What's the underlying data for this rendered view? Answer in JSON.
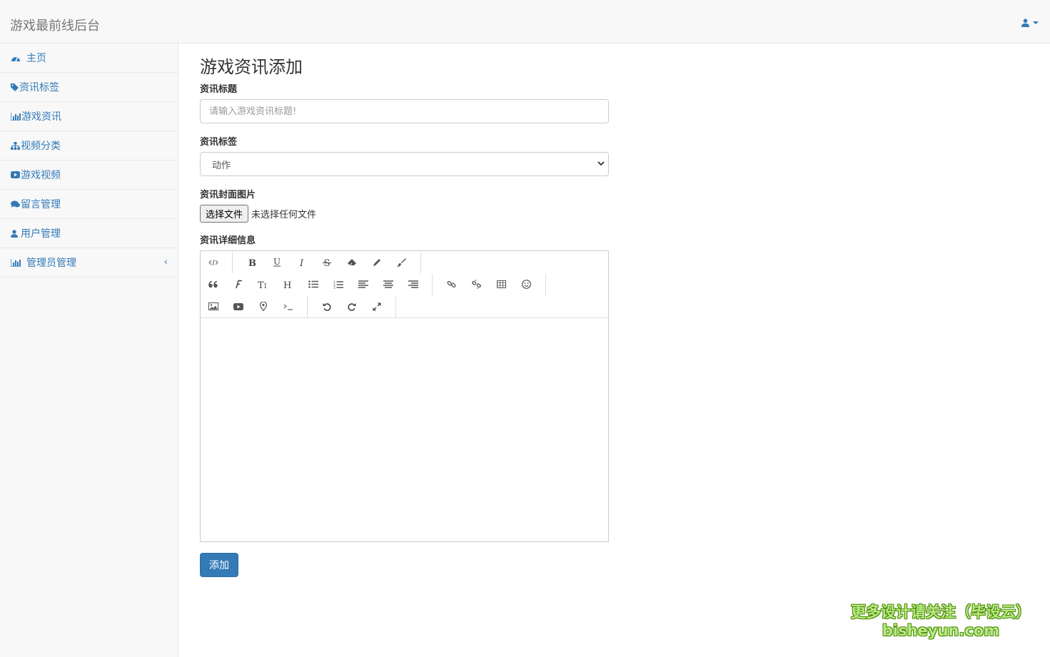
{
  "navbar": {
    "brand": "游戏最前线后台"
  },
  "sidebar": {
    "items": [
      {
        "label": "主页",
        "icon": "dashboard-icon"
      },
      {
        "label": "资讯标签",
        "icon": "tag-icon"
      },
      {
        "label": "游戏资讯",
        "icon": "bar-chart-icon"
      },
      {
        "label": "视频分类",
        "icon": "sitemap-icon"
      },
      {
        "label": "游戏视频",
        "icon": "youtube-play-icon"
      },
      {
        "label": "留言管理",
        "icon": "comments-icon"
      },
      {
        "label": "用户管理",
        "icon": "user-icon"
      },
      {
        "label": "管理员管理",
        "icon": "bar-chart-icon",
        "chevron": "‹"
      }
    ]
  },
  "main": {
    "title": "游戏资讯添加",
    "title_field": {
      "label": "资讯标题",
      "placeholder": "请输入游戏资讯标题!"
    },
    "tag_field": {
      "label": "资讯标签",
      "selected": "动作"
    },
    "cover_field": {
      "label": "资讯封面图片",
      "button": "选择文件",
      "status": "未选择任何文件"
    },
    "detail_field": {
      "label": "资讯详细信息"
    },
    "submit": "添加"
  },
  "toolbar": {
    "row1": [
      "code-view-icon",
      "|",
      "bold-icon",
      "underline-icon",
      "italic-icon",
      "strikethrough-icon",
      "eraser-icon",
      "pencil-icon",
      "brush-icon",
      "|"
    ],
    "row2": [
      "blockquote-icon",
      "font-icon",
      "font-size-icon",
      "heading-icon",
      "unordered-list-icon",
      "ordered-list-icon",
      "align-left-icon",
      "align-center-icon",
      "align-right-icon",
      "|",
      "link-icon",
      "unlink-icon",
      "table-icon",
      "emoji-icon",
      "|"
    ],
    "row3": [
      "image-icon",
      "video-icon",
      "map-marker-icon",
      "terminal-icon",
      "|",
      "undo-icon",
      "redo-icon",
      "fullscreen-icon",
      "|"
    ]
  },
  "watermark": {
    "line1": "更多设计请关注（毕设云）",
    "line2": "bisheyun.com"
  },
  "colors": {
    "link": "#337ab7",
    "primary": "#337ab7",
    "navbar_bg": "#f8f8f8"
  }
}
